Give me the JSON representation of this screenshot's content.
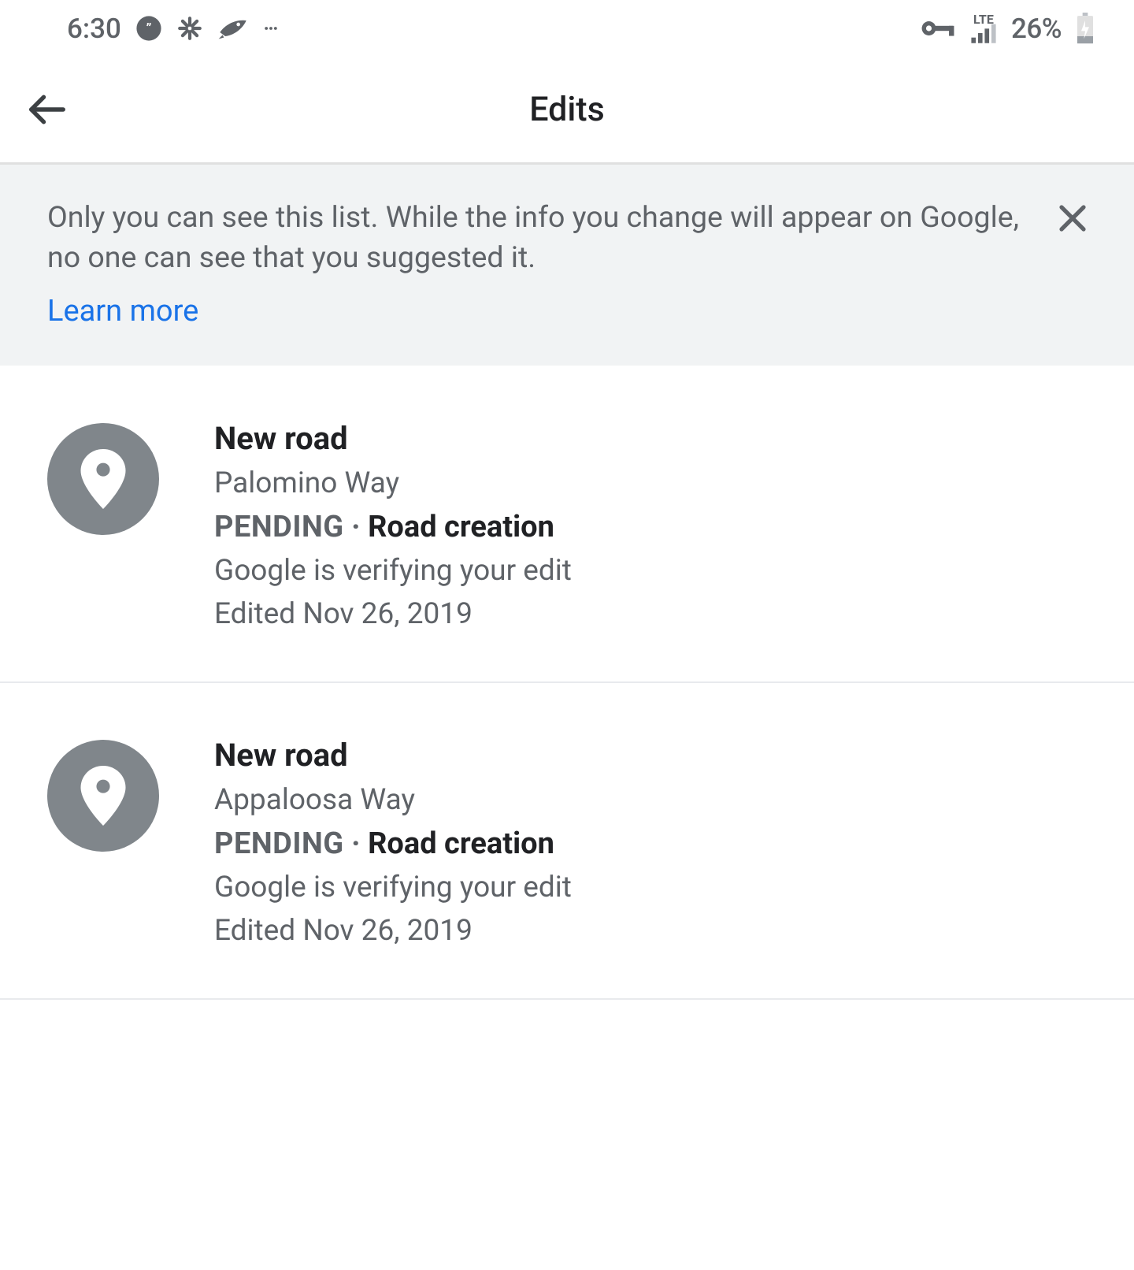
{
  "status_bar": {
    "time": "6:30",
    "network_type": "LTE",
    "battery_percent": "26%"
  },
  "header": {
    "title": "Edits"
  },
  "banner": {
    "text": "Only you can see this list. While the info you change will appear on Google, no one can see that you suggested it.",
    "learn_more": "Learn more"
  },
  "edits": [
    {
      "title": "New road",
      "subtitle": "Palomino Way",
      "status": "PENDING",
      "sep": " · ",
      "type": "Road creation",
      "verify": "Google is verifying your edit",
      "date": "Edited Nov 26, 2019"
    },
    {
      "title": "New road",
      "subtitle": "Appaloosa Way",
      "status": "PENDING",
      "sep": " · ",
      "type": "Road creation",
      "verify": "Google is verifying your edit",
      "date": "Edited Nov 26, 2019"
    }
  ]
}
